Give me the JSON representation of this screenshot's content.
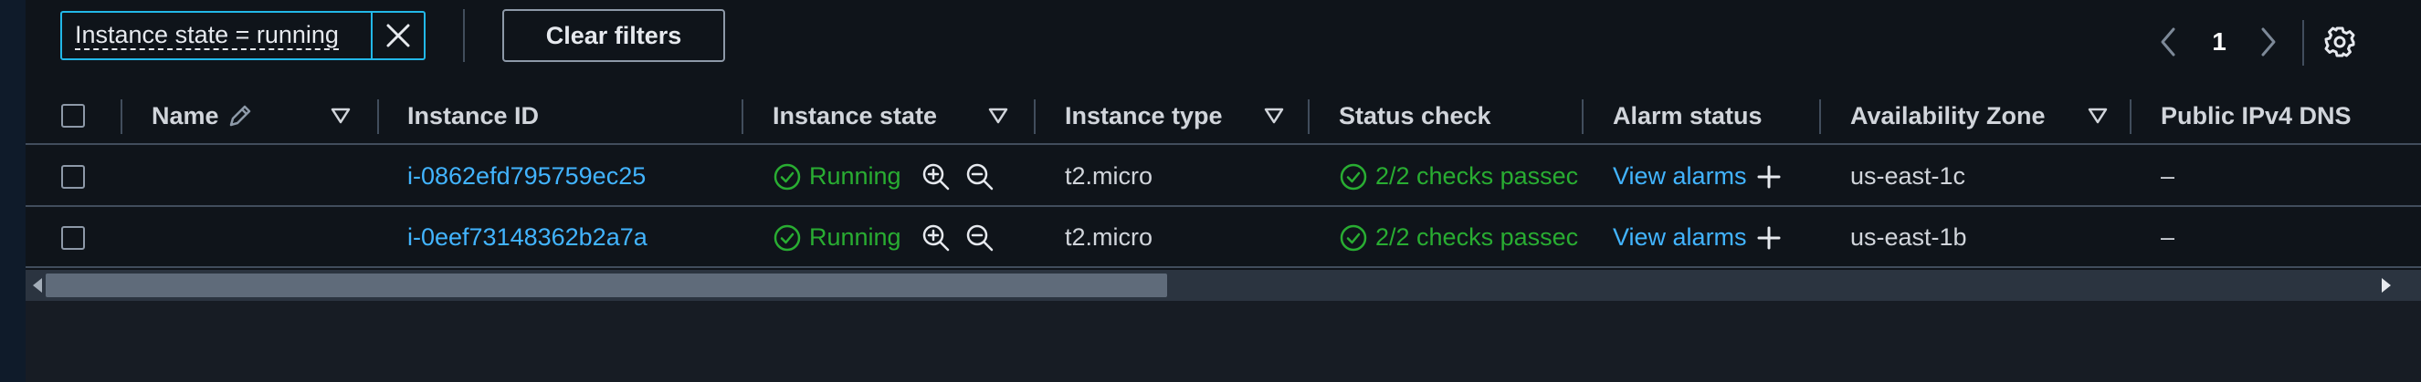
{
  "filter": {
    "token_label": "Instance state = running",
    "clear_button": "Clear filters"
  },
  "pagination": {
    "current_page": "1"
  },
  "columns": {
    "name": "Name",
    "instance_id": "Instance ID",
    "instance_state": "Instance state",
    "instance_type": "Instance type",
    "status_check": "Status check",
    "alarm_status": "Alarm status",
    "availability_zone": "Availability Zone",
    "public_ipv4_dns": "Public IPv4 DNS"
  },
  "rows": [
    {
      "name": "",
      "instance_id": "i-0862efd795759ec25",
      "state": "Running",
      "type": "t2.micro",
      "status_check": "2/2 checks passec",
      "alarm": "View alarms",
      "zone": "us-east-1c",
      "dns": "–"
    },
    {
      "name": "",
      "instance_id": "i-0eef73148362b2a7a",
      "state": "Running",
      "type": "t2.micro",
      "status_check": "2/2 checks passec",
      "alarm": "View alarms",
      "zone": "us-east-1b",
      "dns": "–"
    }
  ],
  "colors": {
    "accent": "#22b8e8",
    "link": "#42b4ff",
    "success": "#29ad32",
    "background": "#0f141a"
  },
  "icons": {
    "remove_filter": "close-icon",
    "edit_name": "pencil-icon",
    "sort": "caret-down-icon",
    "running": "check-circle-icon",
    "zoom_in": "zoom-in-icon",
    "zoom_out": "zoom-out-icon",
    "add_alarm": "plus-icon",
    "settings": "gear-icon"
  }
}
